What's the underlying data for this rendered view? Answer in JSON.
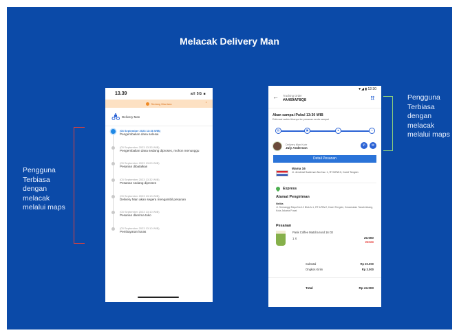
{
  "slide": {
    "title": "Melacak Delivery Man",
    "left_note": "Pengguna Terbiasa dengan melacak melalui maps",
    "right_note": "Pengguna Terbiasa dengan melacak melalui maps",
    "bracket_left_color": "#e0413a",
    "bracket_right_color": "#8fd07a",
    "background": "#0b4aa8"
  },
  "phone_left": {
    "status_time": "13.39",
    "status_icons": "all 5G ■",
    "banner": "Sedang Diantara",
    "courier_label": "Delivery Man",
    "timeline": [
      {
        "date": "(03 September 2023 13:36 WIB)",
        "text": "Pengembalian dana selesai",
        "active": true
      },
      {
        "date": "(03 September 2023 13:33 WIB)",
        "text": "Pengembalian dana sedang diproses, mohon menunggu",
        "active": false
      },
      {
        "date": "(03 September 2023 13:00 WIB)",
        "text": "Pesanan dibatalkan",
        "active": false
      },
      {
        "date": "(03 September 2023 13:32 WIB)",
        "text": "Pesanan sedang diproses",
        "active": false
      },
      {
        "date": "(03 September 2023 13:13 WIB)",
        "text": "Delivery Man akan segera mengambil pesanan",
        "active": false
      },
      {
        "date": "(03 September 2023 13:10 WIB)",
        "text": "Pesanan diterima toko",
        "active": false
      },
      {
        "date": "(03 September 2023 13:10 WIB)",
        "text": "Pembayaran lunas",
        "active": false
      }
    ]
  },
  "phone_right": {
    "status": "▼◢ ▮ 12:30",
    "header_label": "Tracking Order",
    "order_number": "#A469AF8Q8",
    "eta_title": "Akan sampai Pukul 13:30 WIB",
    "eta_sub": "Estimasi waktu tibanya ke pesanan anda sampai",
    "courier_label": "Delivery Man Kurir",
    "courier_name": "July Anderson",
    "detail_button": "Detail Pesanan",
    "store_name": "Wama 16",
    "store_address": "Jl. Jenderal Sudirman No.Kav. 1, RT.5/RW.5, Karet Tengsin",
    "shipping": "Express",
    "address_title": "Alamat Pengiriman",
    "address_name": "Nelita",
    "address_text": "Jl. Semanggi Raya No.12 Blok A-1, RT.1/RW.2, Karet Tengsin, Kecamatan Tanah Abang, Kota Jakarta Pusat",
    "order_title": "Pesanan",
    "item_name": "Pank Coffee Matcha Iced 16 Oz",
    "item_qty": "1 X",
    "item_price": "20.000",
    "item_price_old": "25.000",
    "subtotal_label": "Subtotal",
    "subtotal_value": "Rp 20.000",
    "shipping_cost_label": "Ongkos Kirim",
    "shipping_cost_value": "Rp 3.000",
    "total_label": "Total",
    "total_value": "Rp 23.000",
    "accent": "#2a62d5"
  }
}
